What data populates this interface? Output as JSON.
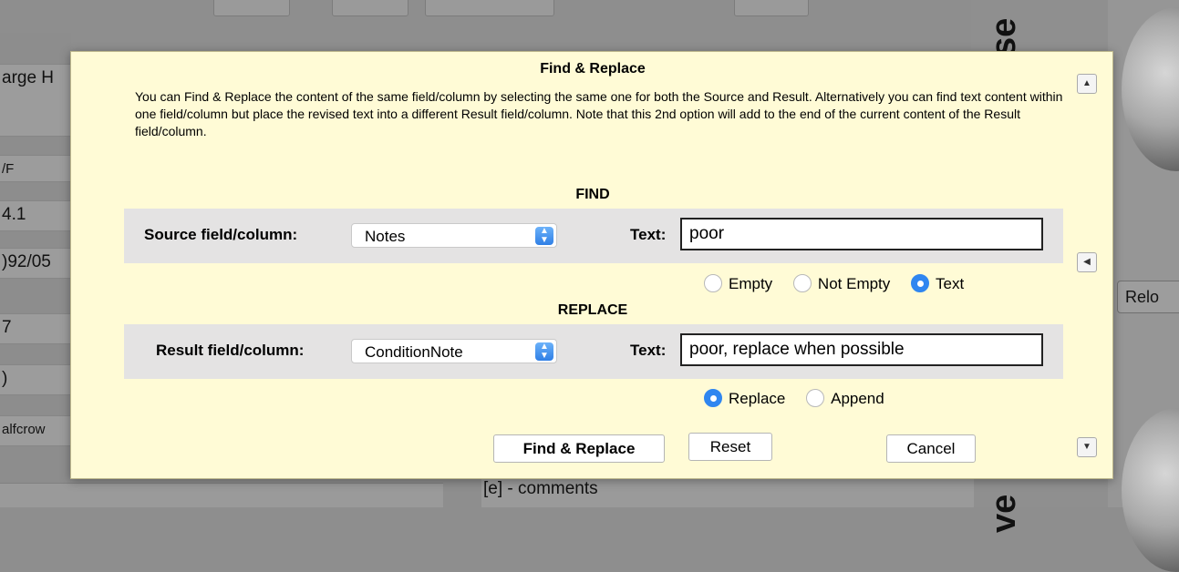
{
  "background": {
    "left_cells": [
      "arge H",
      "/F",
      "4.1",
      ")92/05",
      "7",
      ")",
      "alfcrow"
    ],
    "vertical_texts": [
      "se",
      "ve"
    ],
    "reload_label": "Relo",
    "note_text": "[e]  - comments"
  },
  "dialog": {
    "title": "Find & Replace",
    "description": "You can Find & Replace the content of the same field/column by selecting the same one for both the Source and Result. Alternatively you can find text content within one field/column but place the revised text into a different Result field/column. Note that this 2nd option will add to the end of the current content of the Result field/column.",
    "find": {
      "heading": "FIND",
      "source_label": "Source field/column:",
      "source_value": "Notes",
      "text_label": "Text:",
      "text_value": "poor",
      "options": [
        {
          "label": "Empty",
          "selected": false
        },
        {
          "label": "Not Empty",
          "selected": false
        },
        {
          "label": "Text",
          "selected": true
        }
      ]
    },
    "replace": {
      "heading": "REPLACE",
      "result_label": "Result field/column:",
      "result_value": "ConditionNote",
      "text_label": "Text:",
      "text_value": "poor, replace when possible",
      "options": [
        {
          "label": "Replace",
          "selected": true
        },
        {
          "label": "Append",
          "selected": false
        }
      ]
    },
    "buttons": {
      "find_replace": "Find & Replace",
      "reset": "Reset",
      "cancel": "Cancel"
    },
    "scroll_icons": [
      "scroll-up-icon",
      "scroll-left-icon",
      "scroll-down-icon"
    ]
  },
  "colors": {
    "dialog_bg": "#fffbd6",
    "band_bg": "#e4e3e3",
    "accent": "#2f86f0"
  }
}
